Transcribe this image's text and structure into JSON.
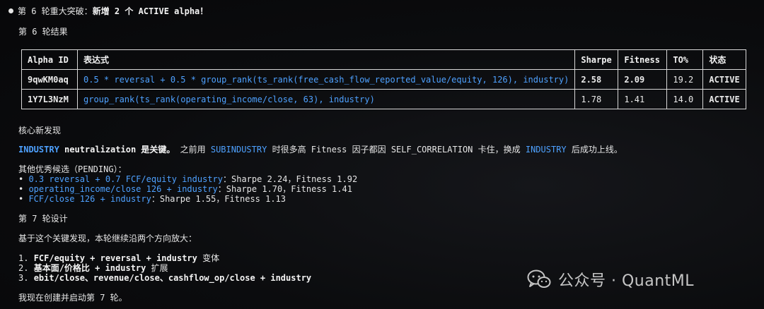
{
  "breakthrough": {
    "prefix": "第 6 轮重大突破：",
    "highlight": "新增 2 个 ACTIVE alpha！"
  },
  "round6_results_heading": "第 6 轮结果",
  "table": {
    "headers": [
      "Alpha ID",
      "表达式",
      "Sharpe",
      "Fitness",
      "TO%",
      "状态"
    ],
    "rows": [
      {
        "id": "9qwKM0aq",
        "expr": "0.5 * reversal + 0.5 * group_rank(ts_rank(free_cash_flow_reported_value/equity, 126), industry)",
        "sharpe": "2.58",
        "fitness": "2.09",
        "to": "19.2",
        "status": "ACTIVE"
      },
      {
        "id": "1Y7L3NzM",
        "expr": "group_rank(ts_rank(operating_income/close, 63), industry)",
        "sharpe": "1.78",
        "fitness": "1.41",
        "to": "14.0",
        "status": "ACTIVE"
      }
    ]
  },
  "core_finding_heading": "核心新发现",
  "core_finding": {
    "t1": "INDUSTRY",
    "t2": " neutralization 是关键。",
    "t3": " 之前用 ",
    "t4": "SUBINDUSTRY",
    "t5": " 时很多高 Fitness 因子都因 SELF_CORRELATION 卡住，换成 ",
    "t6": "INDUSTRY",
    "t7": " 后成功上线。"
  },
  "pending": {
    "heading": "其他优秀候选（PENDING）：",
    "items": [
      {
        "expr": "0.3 reversal + 0.7 FCF/equity industry",
        "stats": "：Sharpe 2.24，Fitness 1.92"
      },
      {
        "expr": "operating_income/close 126 + industry",
        "stats": "：Sharpe 1.70，Fitness 1.41"
      },
      {
        "expr": "FCF/close 126 + industry",
        "stats": "：Sharpe 1.55，Fitness 1.13"
      }
    ]
  },
  "round7_heading": "第 7 轮设计",
  "round7_intro": "基于这个关键发现，本轮继续沿两个方向放大：",
  "round7_items": [
    {
      "num": "1.",
      "bold": "FCF/equity + reversal + industry",
      "rest": " 变体"
    },
    {
      "num": "2.",
      "bold": "基本面/价格比 + industry",
      "rest": " 扩展"
    },
    {
      "num": "3.",
      "bold": "ebit/close、revenue/close、cashflow_op/close + industry",
      "rest": ""
    }
  ],
  "closing": "我现在创建并启动第 7 轮。",
  "watermark": {
    "text": "公众号 · QuantML",
    "icon": "wechat-icon"
  }
}
